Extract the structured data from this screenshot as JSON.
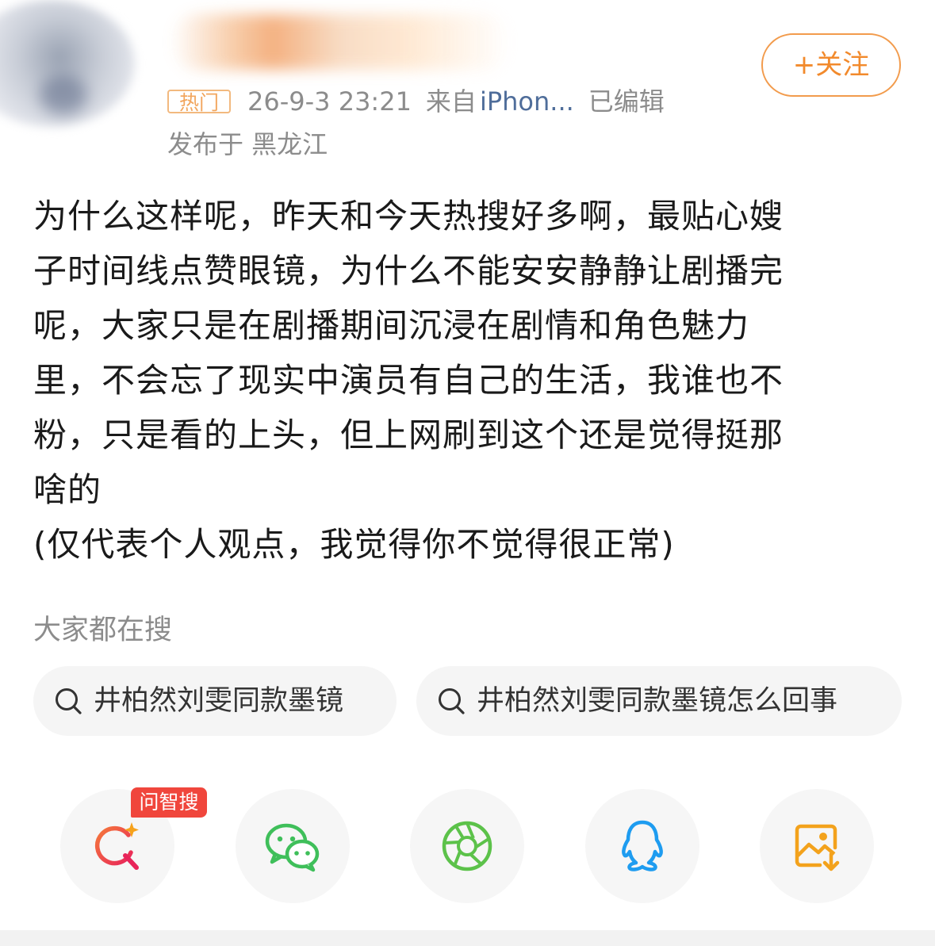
{
  "post": {
    "badge": "热门",
    "timestamp": "26-9-3 23:21",
    "source_prefix": "来自",
    "source": "iPhon...",
    "edited": "已编辑",
    "location": "发布于 黑龙江",
    "follow_label": "+关注",
    "text": "为什么这样呢，昨天和今天热搜好多啊，最贴心嫂\n子时间线点赞眼镜，为什么不能安安静静让剧播完\n呢，大家只是在剧播期间沉浸在剧情和角色魅力\n里，不会忘了现实中演员有自己的生活，我谁也不\n粉，只是看的上头，但上网刷到这个还是觉得挺那\n啥的\n(仅代表个人观点，我觉得你不觉得很正常)"
  },
  "related_search": {
    "title": "大家都在搜",
    "chips": [
      {
        "label": "井柏然刘雯同款墨镜",
        "icon": "search-icon"
      },
      {
        "label": "井柏然刘雯同款墨镜怎么回事",
        "icon": "search-icon"
      }
    ]
  },
  "share": {
    "ai_badge": "问智搜",
    "buttons": [
      {
        "icon": "ai-search-icon",
        "color": "#f0463c"
      },
      {
        "icon": "wechat-icon",
        "color": "#3fbf5a"
      },
      {
        "icon": "moments-icon",
        "color": "#5cc24a"
      },
      {
        "icon": "qq-icon",
        "color": "#1e9cf0"
      },
      {
        "icon": "save-image-icon",
        "color": "#f3a21c"
      }
    ]
  },
  "colors": {
    "accent_orange": "#f28a2c",
    "link_blue": "#4f6d9a",
    "muted_gray": "#8c8c8c"
  }
}
